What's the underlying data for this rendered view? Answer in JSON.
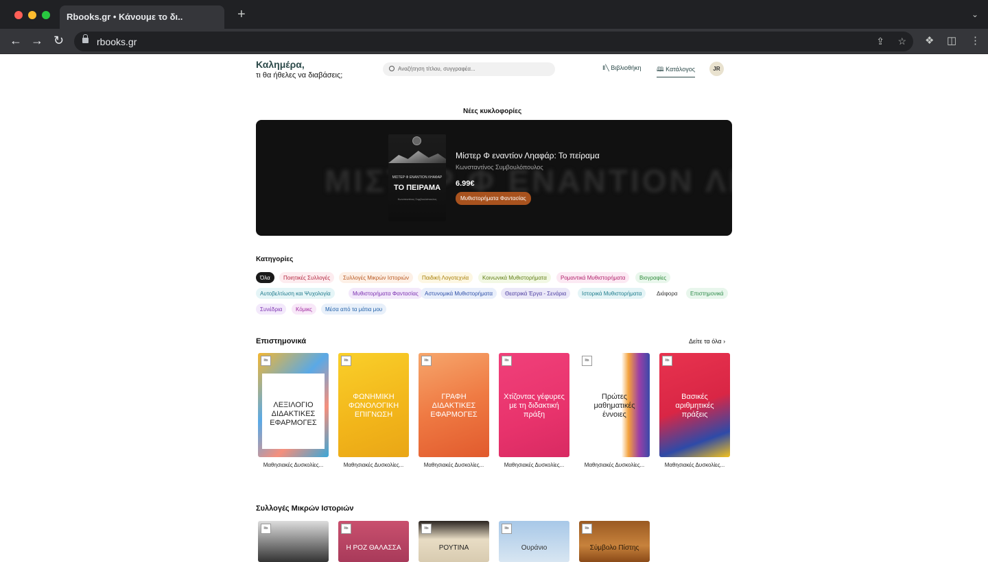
{
  "browser": {
    "tab_title": "Rbooks.gr • Κάνουμε το δι..",
    "new_tab": "+",
    "url": "rbooks.gr"
  },
  "header": {
    "greeting": "Καλημέρα,",
    "subgreeting": "τι θα ήθελες να διαβάσεις;",
    "search_placeholder": "Αναζήτηση τίτλου, συγγραφέα...",
    "nav": [
      "Βιβλιοθήκη",
      "Κατάλογος"
    ],
    "avatar_text": "JR"
  },
  "new_releases": {
    "title": "Νέες κυκλοφορίες",
    "book_title": "Μίστερ Φ εναντίον Ληαφάρ: Το πείραμα",
    "author": "Κωνσταντίνος Συμβουλόπουλος",
    "price": "6.99€",
    "category": "Μυθιστορήματα Φαντασίας",
    "cover_top": "ΜΙΣΤΕΡ Φ ΕΝΑΝΤΙΟΝ ΛΗΑΦΑΡ",
    "cover_title": "ΤΟ ΠΕΙΡΑΜΑ",
    "cover_author": "Κωνσταντίνος Συμβουλόπουλος",
    "blur_text": "ΜΙΣΤΕΡ Φ ΕΝΑΝΤΙΟΝ ΛΗΑΦΑΡ"
  },
  "categories": {
    "title": "Κατηγορίες",
    "chips": [
      {
        "label": "Όλα",
        "color": "#ffffff",
        "bg": "#1a1a1a"
      },
      {
        "label": "Ποιητικές Συλλογές",
        "color": "#b3263f",
        "bg": "#fdecef"
      },
      {
        "label": "Συλλογές Μικρών Ιστοριών",
        "color": "#b8571f",
        "bg": "#fdf0e6"
      },
      {
        "label": "Παιδική Λογοτεχνία",
        "color": "#a67c00",
        "bg": "#fdf7e3"
      },
      {
        "label": "Κοινωνικά Μυθιστορήματα",
        "color": "#5f7d12",
        "bg": "#f2f8e4"
      },
      {
        "label": "Ρομαντικά Μυθιστορήματα",
        "color": "#b0206a",
        "bg": "#fce9f3"
      },
      {
        "label": "Βιογραφίες",
        "color": "#2e8b3a",
        "bg": "#e9f7ec"
      },
      {
        "label": "Αυτοβελτίωση και Ψυχολογία",
        "color": "#1f7a8c",
        "bg": "#e5f5f7"
      },
      {
        "label": "Μυθιστορήματα Φαντασίας",
        "color": "#7a2fb0",
        "bg": "#f3e9fb"
      },
      {
        "label": "Αστυνομικά Μυθιστορήματα",
        "color": "#2d4fa8",
        "bg": "#e9effb"
      },
      {
        "label": "Θεατρικά Έργα - Σενάρια",
        "color": "#4b3ca0",
        "bg": "#ebe8f8"
      },
      {
        "label": "Ιστορικά Μυθιστορήματα",
        "color": "#1d7c8c",
        "bg": "#e4f4f6"
      },
      {
        "label": "Διάφορα",
        "color": "#333333",
        "bg": "#ffffff"
      },
      {
        "label": "Επιστημονικά",
        "color": "#2e8b4a",
        "bg": "#e8f6ec"
      },
      {
        "label": "Συνέδρια",
        "color": "#7a2fb0",
        "bg": "#f3e9fb"
      },
      {
        "label": "Κόμικς",
        "color": "#a02aa0",
        "bg": "#f8e8f8"
      },
      {
        "label": "Μέσα από τα μάτια μου",
        "color": "#1f5fa8",
        "bg": "#e8f0fa"
      }
    ]
  },
  "scientific": {
    "title": "Επιστημονικά",
    "see_all": "Δείτε τα όλα ›",
    "books": [
      {
        "title": "Μαθησιακές Δυσκολίες...",
        "cover_text": "ΛΕΞΙΛΟΓΙΟ ΔΙΔΑΚΤΙΚΕΣ ΕΦΑΡΜΟΓΕΣ",
        "bg": "linear-gradient(135deg,#f2b632 0%,#5aa9e6 40%,#f58f7c 70%,#3aa7d8 100%)",
        "fg": "#222",
        "card": "#ffffff"
      },
      {
        "title": "Μαθησιακές Δυσκολίες...",
        "cover_text": "ΦΩΝΗΜΙΚΗ ΦΩΝΟΛΟΓΙΚΗ ΕΠΙΓΝΩΣΗ",
        "bg": "linear-gradient(160deg,#f9cf2a 0%,#f2b51a 60%,#e9a616 100%)",
        "fg": "#fff",
        "card": "transparent"
      },
      {
        "title": "Μαθησιακές Δυσκολίες...",
        "cover_text": "ΓΡΑΦΗ ΔΙΔΑΚΤΙΚΕΣ ΕΦΑΡΜΟΓΕΣ",
        "bg": "linear-gradient(160deg,#f6a66c 0%,#ef7a43 50%,#e15a2d 100%)",
        "fg": "#fff",
        "card": "transparent"
      },
      {
        "title": "Μαθησιακές Δυσκολίες...",
        "cover_text": "Χτίζοντας γέφυρες με τη διδακτική πράξη",
        "bg": "linear-gradient(160deg,#f0407a 0%,#e8336c 60%,#d82a62 100%)",
        "fg": "#fff",
        "card": "transparent"
      },
      {
        "title": "Μαθησιακές Δυσκολίες...",
        "cover_text": "Πρώτες μαθηματικές έννοιες",
        "bg": "linear-gradient(90deg,#ffffff 0%,#ffffff 60%,#f3a23c 70%,#9b3fa8 85%,#3a4aa8 100%)",
        "fg": "#222",
        "card": "transparent"
      },
      {
        "title": "Μαθησιακές Δυσκολίες...",
        "cover_text": "Βασικές αριθμητικές πράξεις",
        "bg": "linear-gradient(160deg,#e8334f 0%,#d92645 50%,#2e4aa8 80%,#f3c21c 100%)",
        "fg": "#fff",
        "card": "transparent"
      }
    ]
  },
  "short_stories": {
    "title": "Συλλογές Μικρών Ιστοριών",
    "books": [
      {
        "cover_text": "",
        "bg": "linear-gradient(180deg,#ddd 0%,#777 60%,#333 100%)",
        "fg": "#fff"
      },
      {
        "cover_text": "Η ΡΟΖ ΘΑΛΑΣΣΑ",
        "bg": "linear-gradient(180deg,#c9506e 0%,#a83a5a 100%)",
        "fg": "#fff"
      },
      {
        "cover_text": "ΡΟΥΤΙΝΑ",
        "bg": "linear-gradient(180deg,#2b2420 0%,#e8dcc4 45%,#d8cbb0 100%)",
        "fg": "#222"
      },
      {
        "cover_text": "Ουράνιο",
        "bg": "linear-gradient(180deg,#a8c8e8 0%,#d8e6f2 100%)",
        "fg": "#333"
      },
      {
        "cover_text": "Σύμβολο Πίστης",
        "bg": "linear-gradient(180deg,#9a5a22 0%,#c7823c 60%,#8a4a18 100%)",
        "fg": "#2a1a08"
      }
    ]
  }
}
